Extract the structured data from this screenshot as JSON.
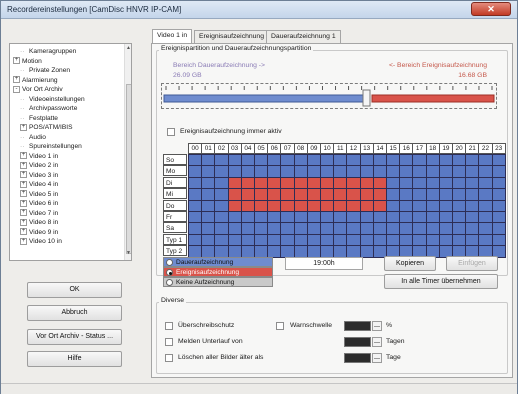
{
  "window": {
    "title": "Recordereinstellungen [CamDisc HNVR IP-CAM]",
    "close_label": "✕"
  },
  "tree": {
    "items": [
      {
        "label": "Kameragruppen",
        "level": 1,
        "expander": ""
      },
      {
        "label": "Motion",
        "level": 0,
        "expander": "+"
      },
      {
        "label": "Private Zonen",
        "level": 1,
        "expander": ""
      },
      {
        "label": "Alarmierung",
        "level": 0,
        "expander": "+"
      },
      {
        "label": "Vor Ort Archiv",
        "level": 0,
        "expander": "-"
      },
      {
        "label": "Videoeinstellungen",
        "level": 1,
        "expander": ""
      },
      {
        "label": "Archivpassworte",
        "level": 1,
        "expander": ""
      },
      {
        "label": "Festplatte",
        "level": 1,
        "expander": ""
      },
      {
        "label": "POS/ATM/IBIS",
        "level": 1,
        "expander": "+"
      },
      {
        "label": "Audio",
        "level": 1,
        "expander": ""
      },
      {
        "label": "Spureinstellungen",
        "level": 1,
        "expander": ""
      },
      {
        "label": "Video 1 in",
        "level": 1,
        "expander": "+"
      },
      {
        "label": "Video 2 in",
        "level": 1,
        "expander": "+"
      },
      {
        "label": "Video 3 in",
        "level": 1,
        "expander": "+"
      },
      {
        "label": "Video 4 in",
        "level": 1,
        "expander": "+"
      },
      {
        "label": "Video 5 in",
        "level": 1,
        "expander": "+"
      },
      {
        "label": "Video 6 in",
        "level": 1,
        "expander": "+"
      },
      {
        "label": "Video 7 in",
        "level": 1,
        "expander": "+"
      },
      {
        "label": "Video 8 in",
        "level": 1,
        "expander": "+"
      },
      {
        "label": "Video 9 in",
        "level": 1,
        "expander": "+"
      },
      {
        "label": "Video 10 in",
        "level": 1,
        "expander": "+"
      }
    ]
  },
  "buttons": {
    "ok": "OK",
    "cancel": "Abbruch",
    "archive_status": "Vor Ort Archiv - Status ...",
    "help": "Hilfe"
  },
  "tabs": [
    {
      "label": "Video 1 in",
      "active": true
    },
    {
      "label": "Ereignisaufzeichnung 1",
      "active": false
    },
    {
      "label": "Daueraufzeichnung 1",
      "active": false
    }
  ],
  "partition": {
    "group_title": "Ereignispartition und Daueraufzeichnungspartition",
    "continuous_label": "Bereich Daueraufzeichnung ->",
    "continuous_size": "26.09 GB",
    "event_label": "<- Bereich Ereignisaufzeichnung",
    "event_size": "16.68 GB",
    "split_fraction": 0.61,
    "continuous_color": "#6f8ccf",
    "event_color": "#d9534a",
    "always_active_label": "Ereignisaufzeichnung immer aktiv",
    "always_active_checked": false
  },
  "schedule": {
    "hours": [
      "00",
      "01",
      "02",
      "03",
      "04",
      "05",
      "06",
      "07",
      "08",
      "09",
      "10",
      "11",
      "12",
      "13",
      "14",
      "15",
      "16",
      "17",
      "18",
      "19",
      "20",
      "21",
      "22",
      "23"
    ],
    "days": [
      "So",
      "Mo",
      "Di",
      "Mi",
      "Do",
      "Fr",
      "Sa",
      "Typ 1",
      "Typ 2"
    ],
    "event_block": {
      "days": [
        "Di",
        "Mi",
        "Do"
      ],
      "from_hour": 3,
      "to_hour": 14
    },
    "colors": {
      "continuous": "#5a79c4",
      "event": "#d9534a",
      "none": "#c9c9c9"
    },
    "legend": [
      {
        "label": "Daueraufzeichnung",
        "color": "#6f8ccf",
        "selected": false
      },
      {
        "label": "Ereignisaufzeichnung",
        "color": "#d9534a",
        "selected": true
      },
      {
        "label": "Keine Aufzeichnung",
        "color": "#c9c9c9",
        "selected": false
      }
    ],
    "time_value": "19:00h",
    "copy_label": "Kopieren",
    "paste_label": "Einfügen",
    "apply_all_label": "In alle Timer übernehmen"
  },
  "misc": {
    "group_title": "Diverse",
    "overwrite_label": "Überschreibschutz",
    "threshold_label": "Warnschwelle",
    "threshold_unit": "%",
    "underrun_label": "Melden Unterlauf von",
    "underrun_unit": "Tagen",
    "delete_label": "Löschen aller Bilder älter als",
    "delete_unit": "Tage"
  }
}
